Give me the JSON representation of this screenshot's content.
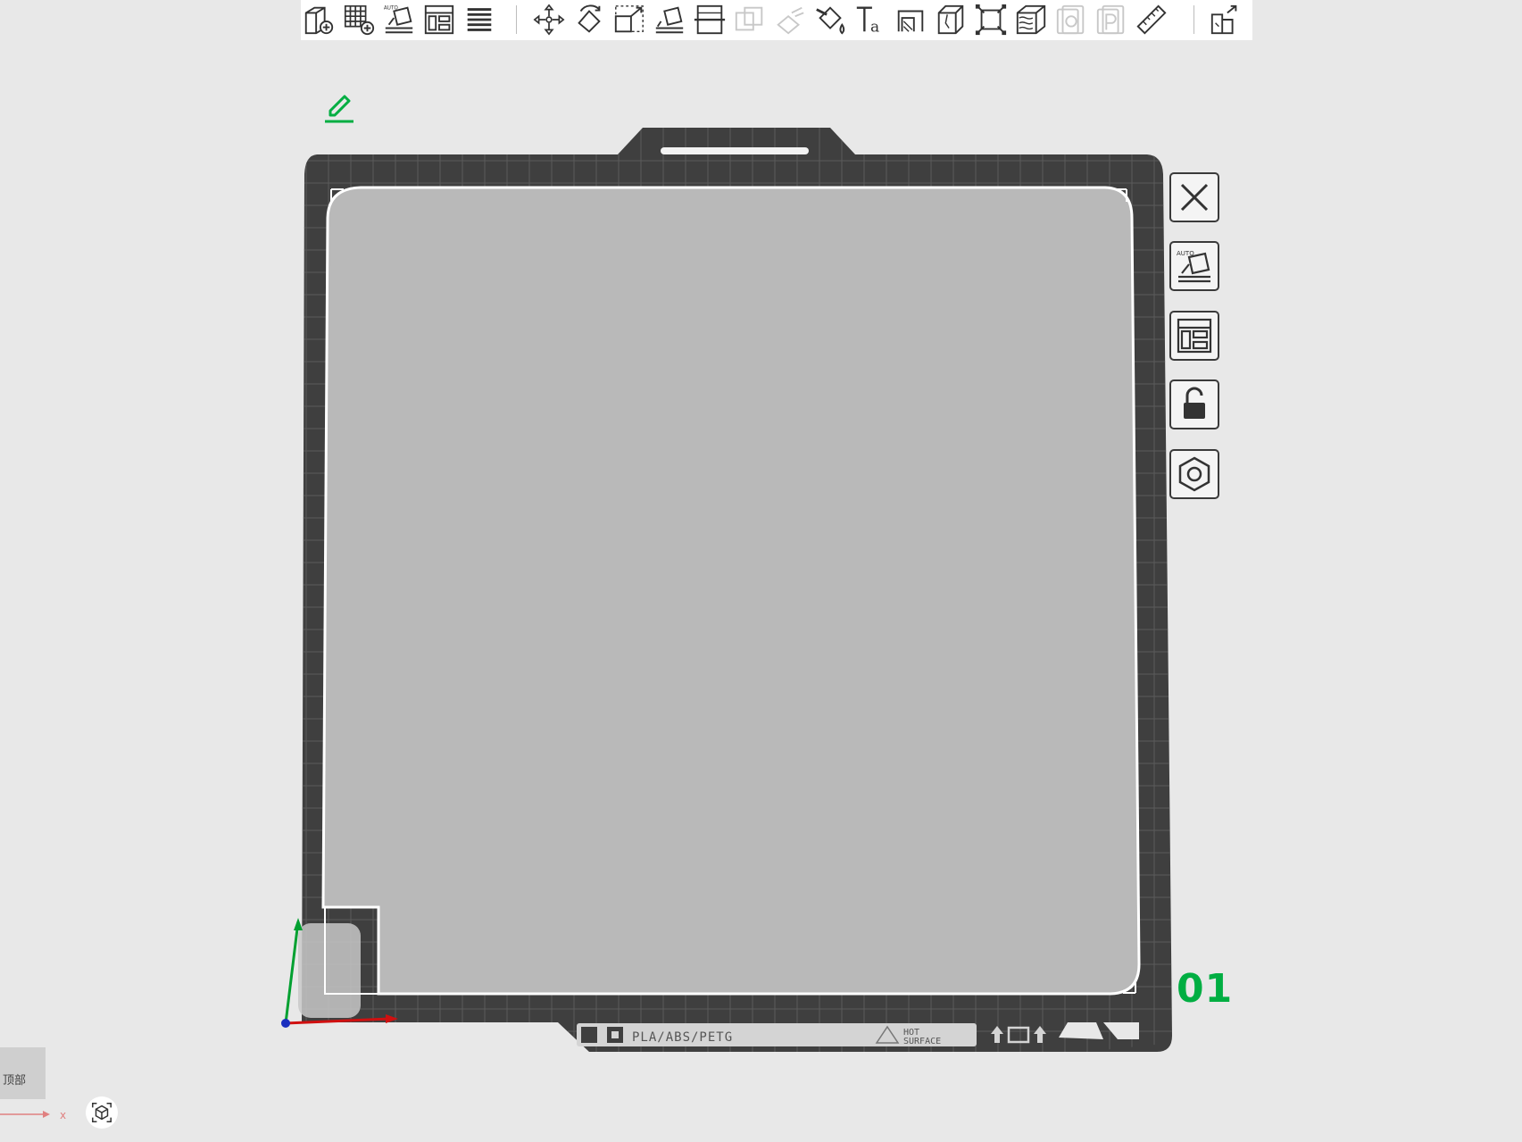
{
  "toolbar": {
    "items": [
      {
        "name": "add-object-icon"
      },
      {
        "name": "add-plate-icon"
      },
      {
        "name": "auto-orient-icon"
      },
      {
        "name": "arrange-icon"
      },
      {
        "name": "split-objects-icon"
      },
      {
        "name": "move-icon"
      },
      {
        "name": "rotate-icon"
      },
      {
        "name": "scale-icon"
      },
      {
        "name": "lay-on-face-icon"
      },
      {
        "name": "cut-icon"
      },
      {
        "name": "boolean-icon"
      },
      {
        "name": "support-paint-icon"
      },
      {
        "name": "color-paint-icon"
      },
      {
        "name": "text-icon"
      },
      {
        "name": "measure-icon"
      },
      {
        "name": "assembly-icon"
      },
      {
        "name": "fit-view-icon"
      },
      {
        "name": "variable-layer-height-icon"
      },
      {
        "name": "copy-icon"
      },
      {
        "name": "paste-icon"
      },
      {
        "name": "ruler-icon"
      },
      {
        "name": "explode-icon"
      }
    ]
  },
  "bed": {
    "material_label": "PLA/ABS/PETG",
    "hot_surface_label": [
      "HOT",
      "SURFACE"
    ]
  },
  "plate": {
    "number": "01",
    "side_buttons": [
      {
        "name": "close-plate-icon"
      },
      {
        "name": "auto-orient-plate-icon"
      },
      {
        "name": "arrange-plate-icon"
      },
      {
        "name": "lock-plate-icon"
      },
      {
        "name": "plate-settings-icon"
      }
    ]
  },
  "view": {
    "cube_label": "顶部",
    "axis_x_label": "x"
  },
  "colors": {
    "accent_green": "#00ae42",
    "bed_dark": "#3f3f3f",
    "plate_gray": "#b9b9b9",
    "axis_x": "#d01010",
    "axis_y": "#00a030",
    "axis_z": "#1a2fbf"
  }
}
